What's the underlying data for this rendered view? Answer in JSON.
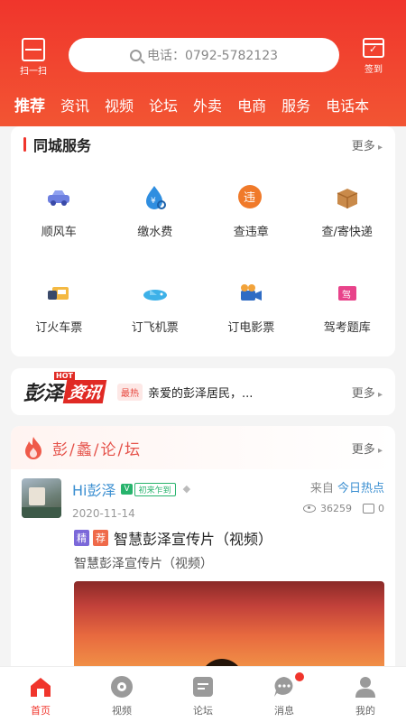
{
  "header": {
    "scan_label": "扫一扫",
    "search_placeholder": "电话：0792-5782123",
    "checkin_label": "签到"
  },
  "tabs": [
    {
      "label": "推荐",
      "active": true
    },
    {
      "label": "资讯"
    },
    {
      "label": "视频"
    },
    {
      "label": "论坛"
    },
    {
      "label": "外卖"
    },
    {
      "label": "电商"
    },
    {
      "label": "服务"
    },
    {
      "label": "电话本"
    }
  ],
  "services": {
    "title": "同城服务",
    "more": "更多",
    "items": [
      {
        "label": "顺风车",
        "icon": "car-icon"
      },
      {
        "label": "缴水费",
        "icon": "water-drop-icon"
      },
      {
        "label": "查违章",
        "icon": "violation-icon"
      },
      {
        "label": "查/寄快递",
        "icon": "package-icon"
      },
      {
        "label": "订火车票",
        "icon": "train-icon"
      },
      {
        "label": "订飞机票",
        "icon": "plane-icon"
      },
      {
        "label": "订电影票",
        "icon": "movie-camera-icon"
      },
      {
        "label": "驾考题库",
        "icon": "driving-book-icon"
      }
    ]
  },
  "news": {
    "logo_main": "彭泽",
    "logo_sub": "资讯",
    "logo_hot": "HOT",
    "tag": "最热",
    "headline": "亲爱的彭泽居民，...",
    "more": "更多"
  },
  "forum": {
    "title": "彭/蠡/论/坛",
    "more": "更多",
    "post": {
      "username": "Hi彭泽",
      "badge": "V",
      "level": "初来乍到",
      "date": "2020-11-14",
      "source_prefix": "来自",
      "source": "今日热点",
      "views": "36259",
      "comments": "0",
      "tag1": "精",
      "tag2": "荐",
      "title": "智慧彭泽宣传片（视频）",
      "subtitle": "智慧彭泽宣传片（视频）"
    }
  },
  "tabbar": [
    {
      "label": "首页",
      "icon": "home-icon",
      "active": true
    },
    {
      "label": "视频",
      "icon": "video-icon"
    },
    {
      "label": "论坛",
      "icon": "forum-icon"
    },
    {
      "label": "消息",
      "icon": "message-icon",
      "badge": true
    },
    {
      "label": "我的",
      "icon": "user-icon"
    }
  ],
  "colors": {
    "brand": "#f0352c",
    "link": "#3b8fd1"
  }
}
